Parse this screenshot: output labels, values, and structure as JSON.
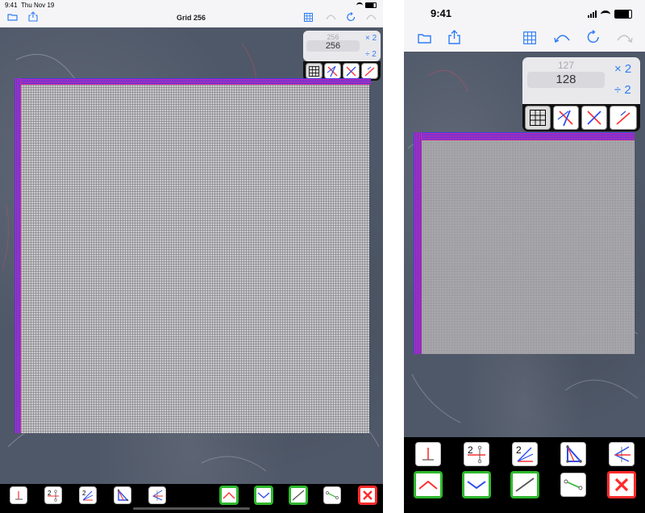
{
  "ipad": {
    "status": {
      "time": "9:41",
      "date": "Thu Nov 19"
    },
    "title": "Grid 256",
    "counter": {
      "previous": "256",
      "current": "256"
    },
    "multiply_label": "× 2",
    "divide_label": "÷ 2",
    "icons": {
      "folder": "folder-icon",
      "share": "share-icon",
      "grid": "grid-icon",
      "undo": "undo-icon",
      "redo": "redo-icon",
      "refresh": "refresh-icon"
    }
  },
  "iphone": {
    "status": {
      "time": "9:41"
    },
    "counter": {
      "previous": "127",
      "current": "128"
    },
    "multiply_label": "× 2",
    "divide_label": "÷ 2"
  },
  "colors": {
    "accent": "#2f7cf6",
    "paper": "#4f5868",
    "grid": "#c9c9cc",
    "stripe_blue": "#3a3af0",
    "stripe_pink": "#e2269b",
    "toggle_green": "#2eb82e",
    "close_red": "#ff2a2a"
  }
}
